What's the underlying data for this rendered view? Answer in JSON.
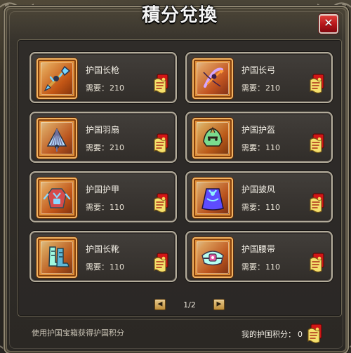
{
  "window": {
    "title": "積分兌換",
    "close_icon": "✕"
  },
  "items": [
    {
      "name": "护国长枪",
      "cost_label": "需要：",
      "cost_value": "210",
      "icon_name": "spear-icon",
      "exchange_icon_name": "exchange-ticket-icon",
      "icon_colors": {
        "primary": "#76d6ff",
        "secondary": "#d6a041",
        "accent": "#2a3550"
      }
    },
    {
      "name": "护国长弓",
      "cost_label": "需要：",
      "cost_value": "210",
      "icon_name": "bow-icon",
      "exchange_icon_name": "exchange-ticket-icon",
      "icon_colors": {
        "primary": "#d4a6ff",
        "secondary": "#ff9a39",
        "accent": "#3b1e4c"
      }
    },
    {
      "name": "护国羽扇",
      "cost_label": "需要：",
      "cost_value": "210",
      "icon_name": "fan-icon",
      "exchange_icon_name": "exchange-ticket-icon",
      "icon_colors": {
        "primary": "#b6ddff",
        "secondary": "#6e6f9c",
        "accent": "#283243"
      }
    },
    {
      "name": "护国护盔",
      "cost_label": "需要：",
      "cost_value": "110",
      "icon_name": "helmet-icon",
      "exchange_icon_name": "exchange-ticket-icon",
      "icon_colors": {
        "primary": "#7adb8e",
        "secondary": "#c3a24c",
        "accent": "#2a1e18"
      }
    },
    {
      "name": "护国护甲",
      "cost_label": "需要：",
      "cost_value": "110",
      "icon_name": "armor-icon",
      "exchange_icon_name": "exchange-ticket-icon",
      "icon_colors": {
        "primary": "#d64b4b",
        "secondary": "#8ad9ff",
        "accent": "#314e5a"
      }
    },
    {
      "name": "护国披风",
      "cost_label": "需要：",
      "cost_value": "110",
      "icon_name": "cape-icon",
      "exchange_icon_name": "exchange-ticket-icon",
      "icon_colors": {
        "primary": "#5e4cff",
        "secondary": "#8ff2ff",
        "accent": "#20163e"
      }
    },
    {
      "name": "护国长靴",
      "cost_label": "需要：",
      "cost_value": "110",
      "icon_name": "boots-icon",
      "exchange_icon_name": "exchange-ticket-icon",
      "icon_colors": {
        "primary": "#9ff8df",
        "secondary": "#5fb7d6",
        "accent": "#24414b"
      }
    },
    {
      "name": "护国腰带",
      "cost_label": "需要：",
      "cost_value": "110",
      "icon_name": "belt-icon",
      "exchange_icon_name": "exchange-ticket-icon",
      "icon_colors": {
        "primary": "#b6fff2",
        "secondary": "#e35ca6",
        "accent": "#40354a"
      }
    }
  ],
  "pagination": {
    "previous_icon": "◀",
    "page_indicator": "1/2",
    "next_icon": "▶"
  },
  "footer": {
    "hint": "使用护国宝箱获得护国积分",
    "points_label": "我的护国积分：",
    "points_value": "0",
    "ticket_icon_name": "points-ticket-icon"
  },
  "colors": {
    "panel_border": "#b2ab9a",
    "title_text": "#f5f5f5",
    "close_button": "#b4161a",
    "item_frame": "#f2b462"
  }
}
